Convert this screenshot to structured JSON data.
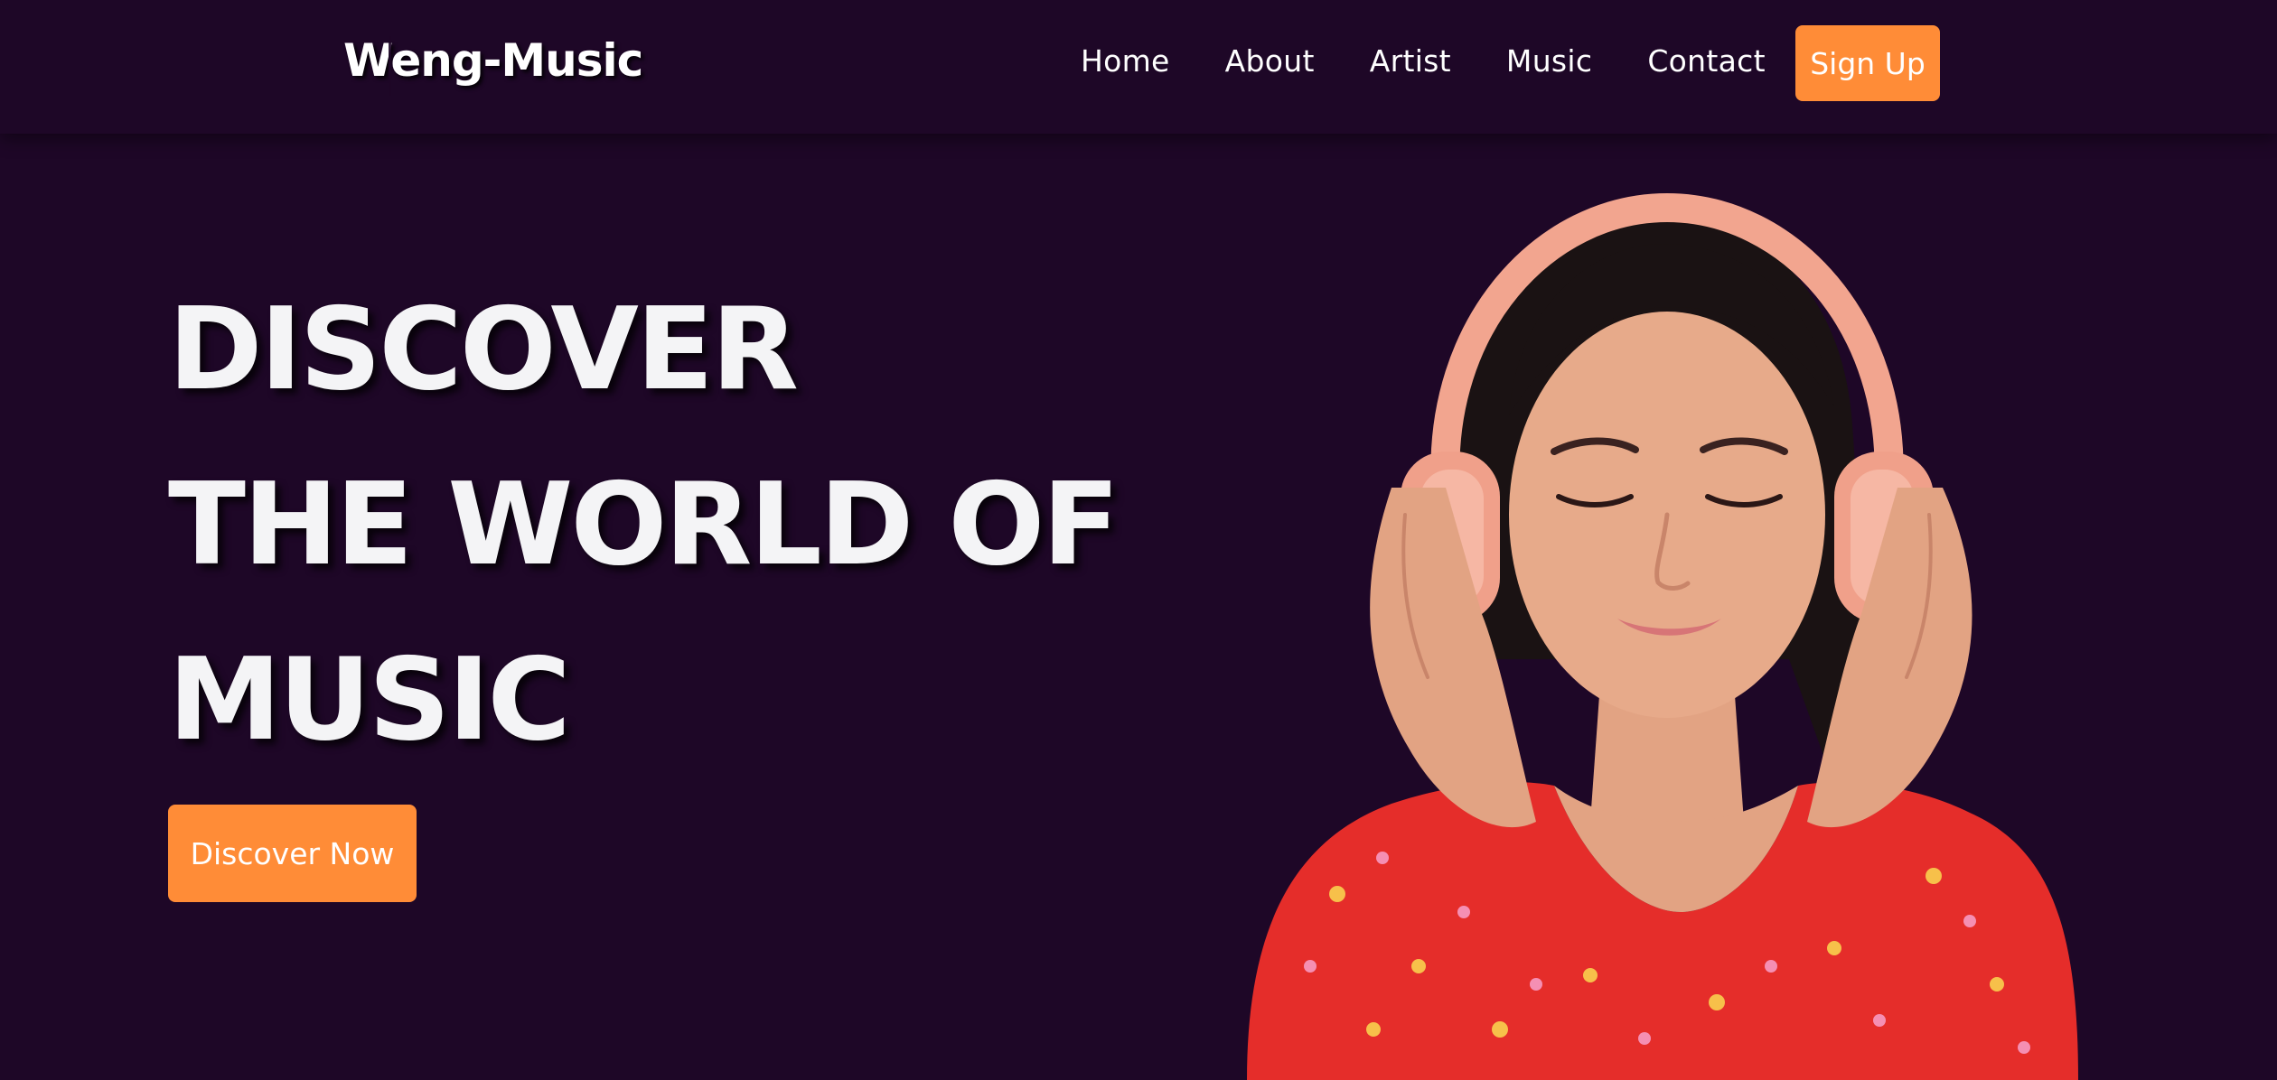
{
  "header": {
    "logo": "Weng-Music",
    "nav": [
      {
        "label": "Home"
      },
      {
        "label": "About"
      },
      {
        "label": "Artist"
      },
      {
        "label": "Music"
      },
      {
        "label": "Contact"
      }
    ],
    "signup_label": "Sign Up"
  },
  "hero": {
    "title_lines": [
      "DISCOVER",
      "THE WORLD OF",
      "MUSIC"
    ],
    "cta_label": "Discover Now",
    "image_subject": "woman-with-headphones"
  },
  "colors": {
    "background": "#1e0727",
    "accent": "#ff8c37",
    "text": "#f4f4f6"
  }
}
